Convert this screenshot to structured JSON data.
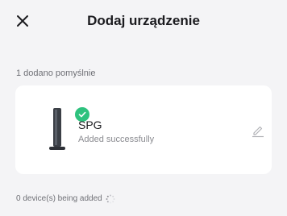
{
  "header": {
    "title": "Dodaj urządzenie",
    "close_icon": "close-icon"
  },
  "results": {
    "success_count_text": "1 dodano pomyślnie"
  },
  "device": {
    "name": "SPG",
    "status": "Added successfully",
    "status_color": "#2ec27e",
    "edit_icon": "pencil-icon"
  },
  "footer": {
    "adding_text": "0 device(s) being added"
  },
  "colors": {
    "background": "#f4f4f6",
    "card": "#ffffff",
    "success": "#2ec27e",
    "text_primary": "#1b1b1f",
    "text_secondary": "#6f7076"
  }
}
